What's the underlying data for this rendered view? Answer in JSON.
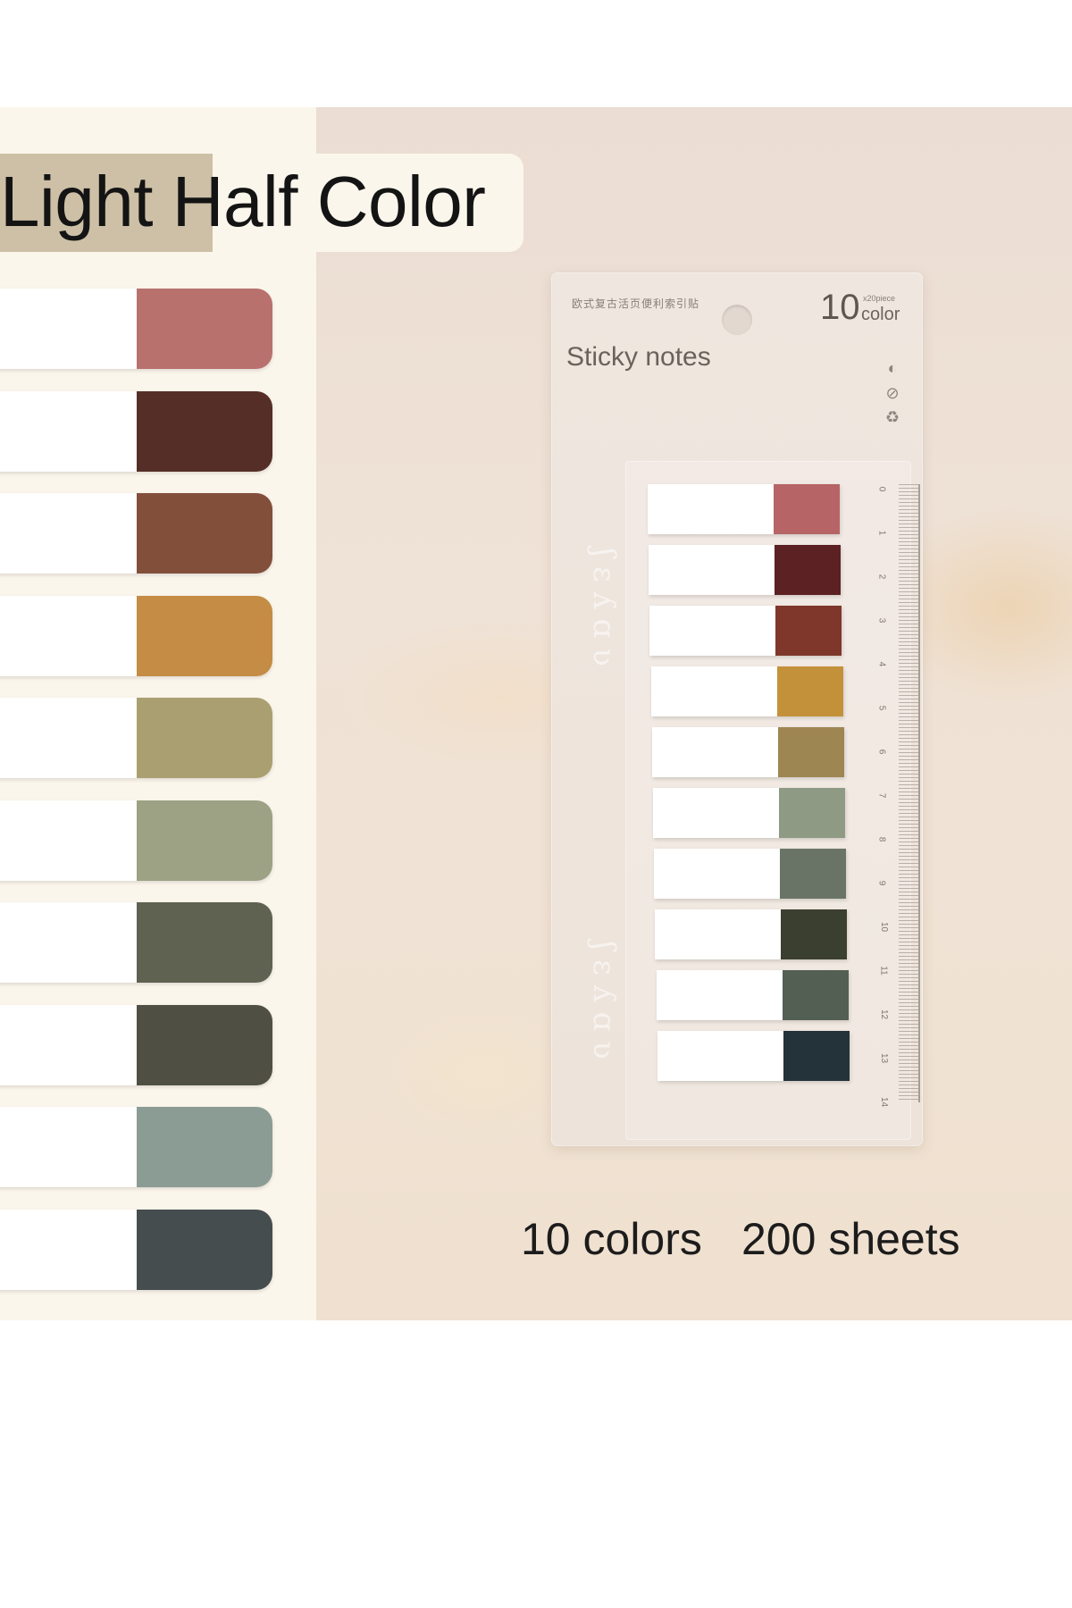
{
  "title": "Light Half Color",
  "package": {
    "chinese_text": "欧式复古活页便利索引贴",
    "count": "10",
    "per_piece": "x20piece",
    "count_unit": "color",
    "name": "Sticky notes",
    "icons": [
      "half-circle-icon",
      "check-circle-icon",
      "recycle-icon"
    ],
    "ruler_numbers": [
      "0",
      "1",
      "2",
      "3",
      "4",
      "5",
      "6",
      "7",
      "8",
      "9",
      "10",
      "11",
      "12",
      "13",
      "14"
    ]
  },
  "palette_large": [
    "#b9716e",
    "#542e27",
    "#824f3b",
    "#c48c44",
    "#aa9f70",
    "#9ca283",
    "#5f6151",
    "#4f5043",
    "#8b9c95",
    "#464d4f"
  ],
  "palette_package": [
    "#b66466",
    "#5c2123",
    "#7f372b",
    "#c4913b",
    "#9e8653",
    "#8e9a83",
    "#6a7466",
    "#3a3f30",
    "#545f54",
    "#24323a"
  ],
  "captions": {
    "colors": "10 colors",
    "sheets": "200 sheets"
  }
}
